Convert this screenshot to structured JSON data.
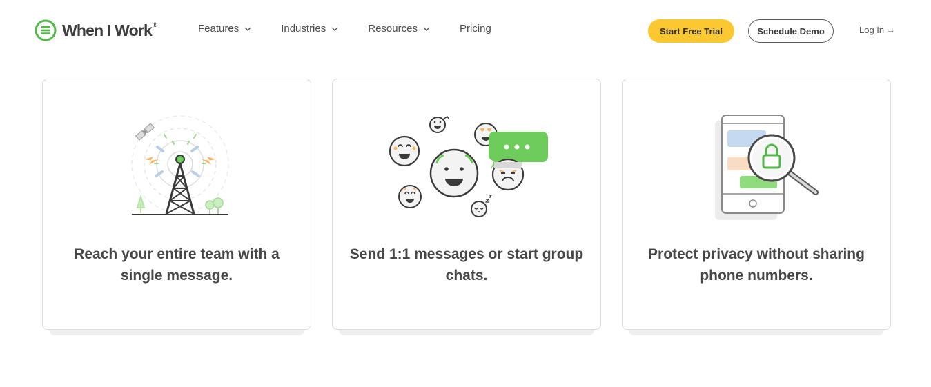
{
  "header": {
    "logo_text": "When I Work",
    "logo_reg": "®",
    "nav": [
      {
        "label": "Features",
        "has_dropdown": true
      },
      {
        "label": "Industries",
        "has_dropdown": true
      },
      {
        "label": "Resources",
        "has_dropdown": true
      },
      {
        "label": "Pricing",
        "has_dropdown": false
      }
    ],
    "start_trial_label": "Start Free Trial",
    "schedule_demo_label": "Schedule Demo",
    "login_label": "Log In",
    "login_arrow": "→"
  },
  "cards": [
    {
      "title": "Reach your entire team with a single message.",
      "icon": "radio-tower-icon"
    },
    {
      "title": "Send 1:1 messages or start group chats.",
      "icon": "group-chat-emoji-icon"
    },
    {
      "title": "Protect privacy without sharing phone numbers.",
      "icon": "phone-privacy-lock-icon"
    }
  ],
  "colors": {
    "brand_green": "#51b848",
    "accent_yellow": "#fcc832",
    "text_dark": "#474747"
  }
}
